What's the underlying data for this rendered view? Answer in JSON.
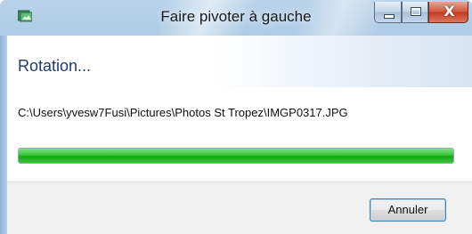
{
  "window": {
    "title": "Faire pivoter à gauche",
    "app_icon": "photo-gallery-icon",
    "caption_buttons": [
      "minimize-icon",
      "maximize-icon",
      "close-icon"
    ],
    "close_glyph": "X"
  },
  "dialog": {
    "heading": "Rotation...",
    "file_path": "C:\\Users\\yvesw7Fusi\\Pictures\\Photos St Tropez\\IMGP0317.JPG",
    "progress_fraction": 1.0,
    "progress_color": "#22b422"
  },
  "footer": {
    "cancel_label": "Annuler"
  }
}
